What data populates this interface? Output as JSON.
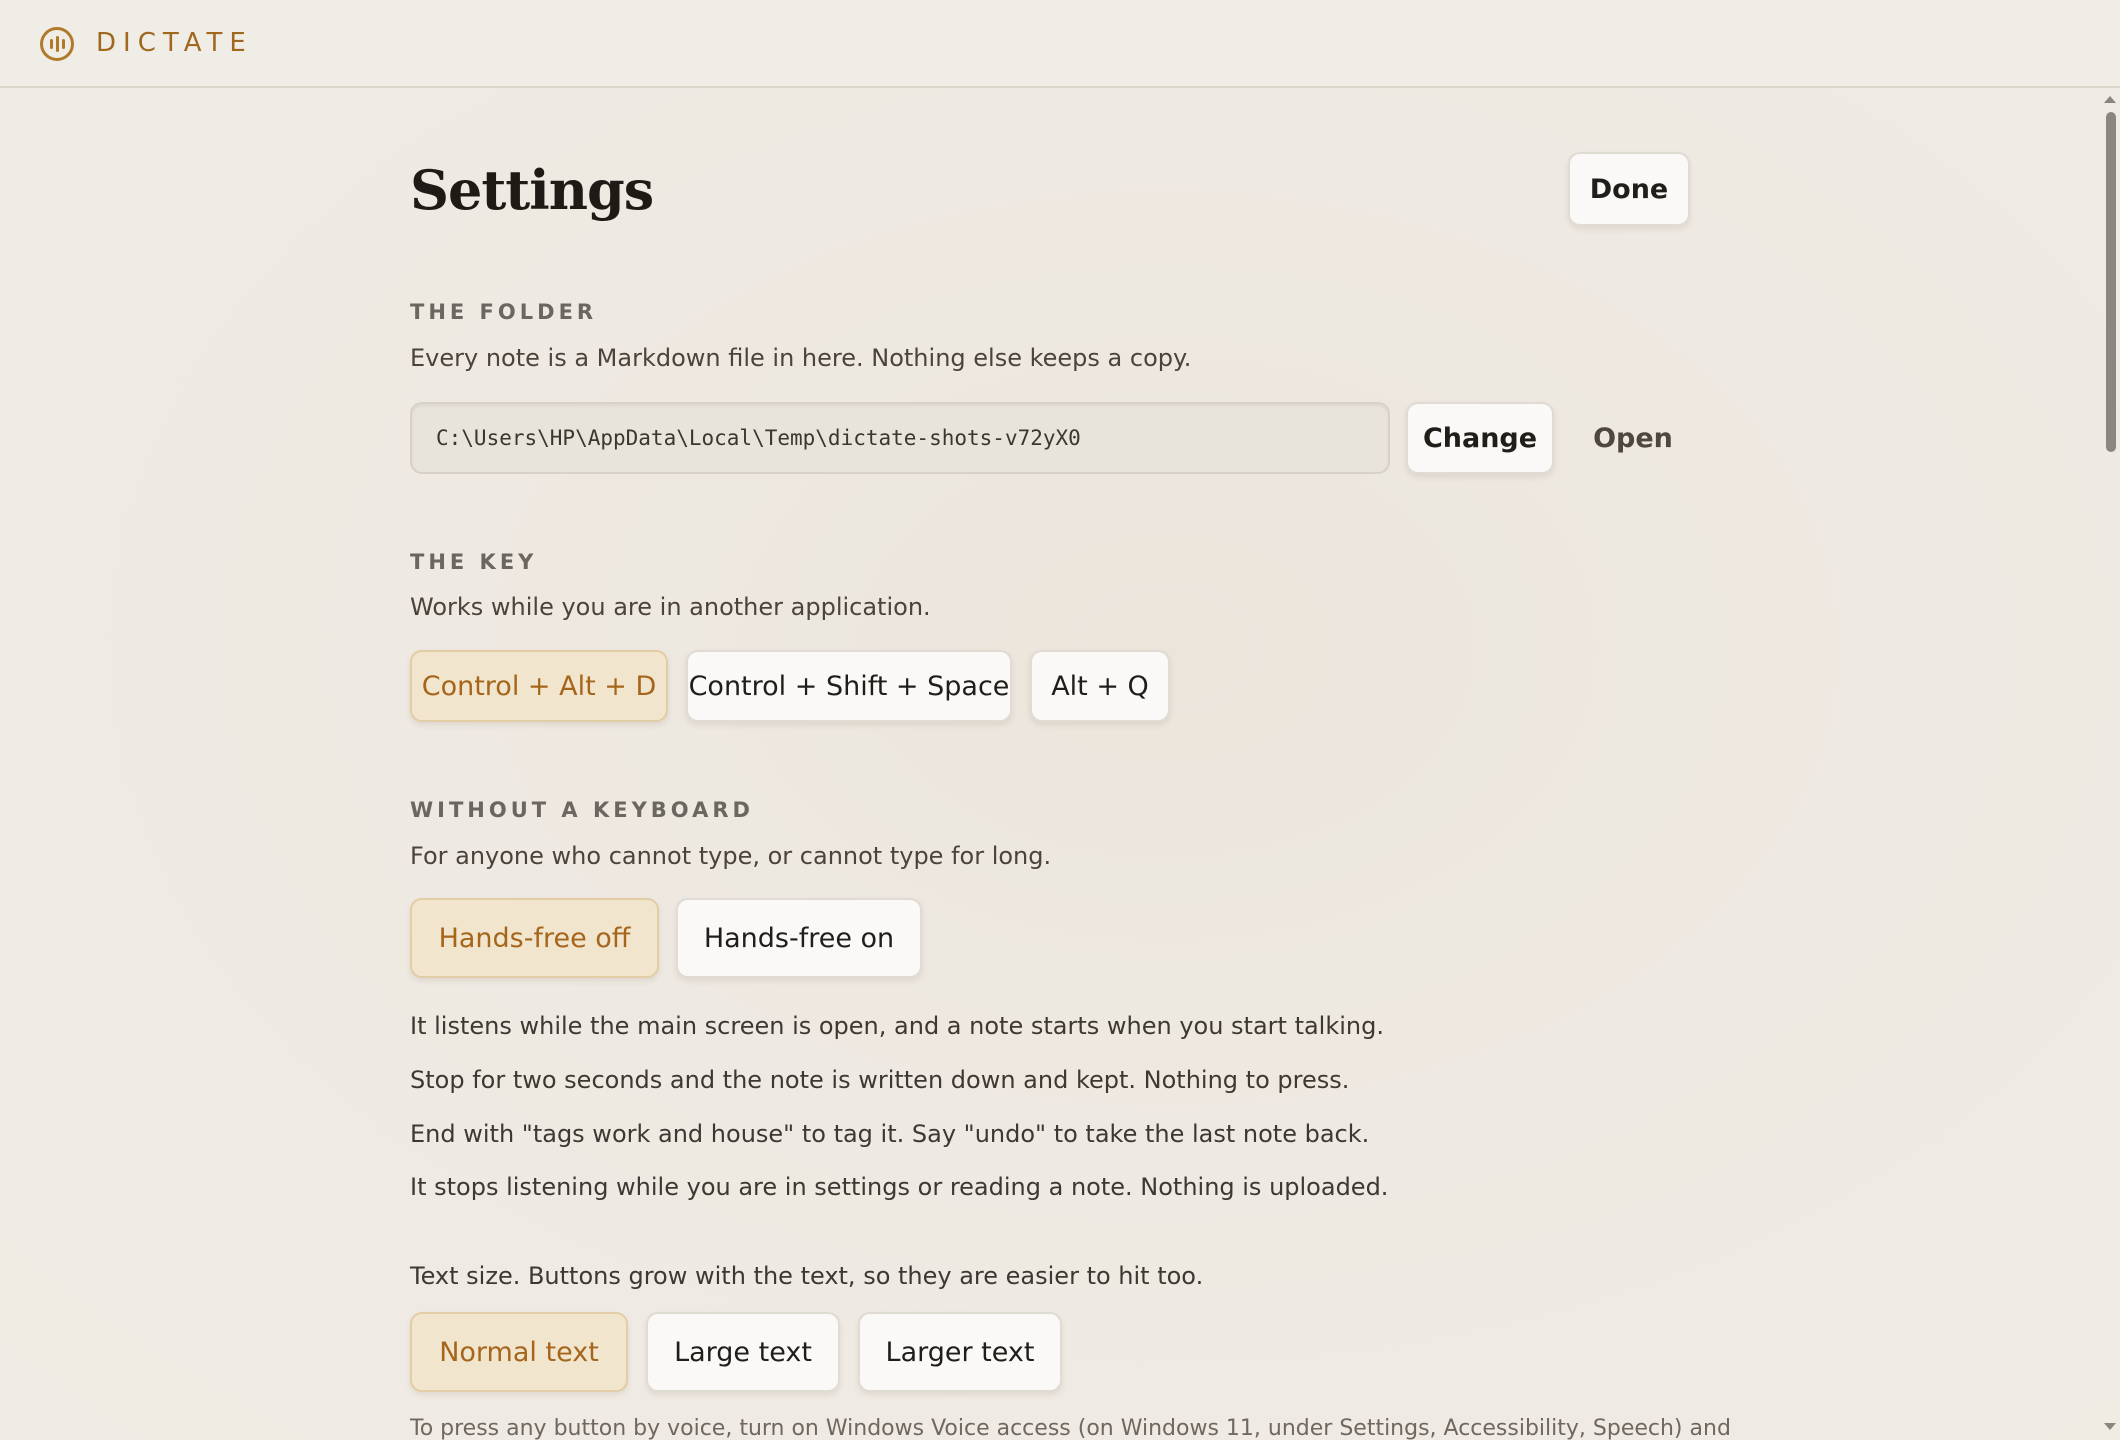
{
  "app": {
    "name": "DICTATE"
  },
  "page": {
    "title": "Settings",
    "done_label": "Done"
  },
  "folder": {
    "label": "THE FOLDER",
    "description": "Every note is a Markdown file in here. Nothing else keeps a copy.",
    "path": "C:\\Users\\HP\\AppData\\Local\\Temp\\dictate-shots-v72yX0",
    "change_label": "Change",
    "open_label": "Open"
  },
  "key": {
    "label": "THE KEY",
    "description": "Works while you are in another application.",
    "options": [
      "Control + Alt + D",
      "Control + Shift + Space",
      "Alt + Q"
    ],
    "selected": "Control + Alt + D"
  },
  "keyboardless": {
    "label": "WITHOUT A KEYBOARD",
    "description": "For anyone who cannot type, or cannot type for long.",
    "options": [
      "Hands-free off",
      "Hands-free on"
    ],
    "selected": "Hands-free off",
    "notes": [
      "It listens while the main screen is open, and a note starts when you start talking.",
      "Stop for two seconds and the note is written down and kept. Nothing to press.",
      "End with \"tags work and house\" to tag it. Say \"undo\" to take the last note back.",
      "It stops listening while you are in settings or reading a note. Nothing is uploaded."
    ]
  },
  "text_size": {
    "description": "Text size. Buttons grow with the text, so they are easier to hit too.",
    "options": [
      "Normal text",
      "Large text",
      "Larger text"
    ],
    "selected": "Normal text"
  },
  "voice_access_note": "To press any button by voice, turn on Windows Voice access (on Windows 11, under Settings, Accessibility, Speech) and",
  "colors": {
    "accent": "#a5661b",
    "selected_bg": "#f2e5cd",
    "background": "#efebe4"
  }
}
